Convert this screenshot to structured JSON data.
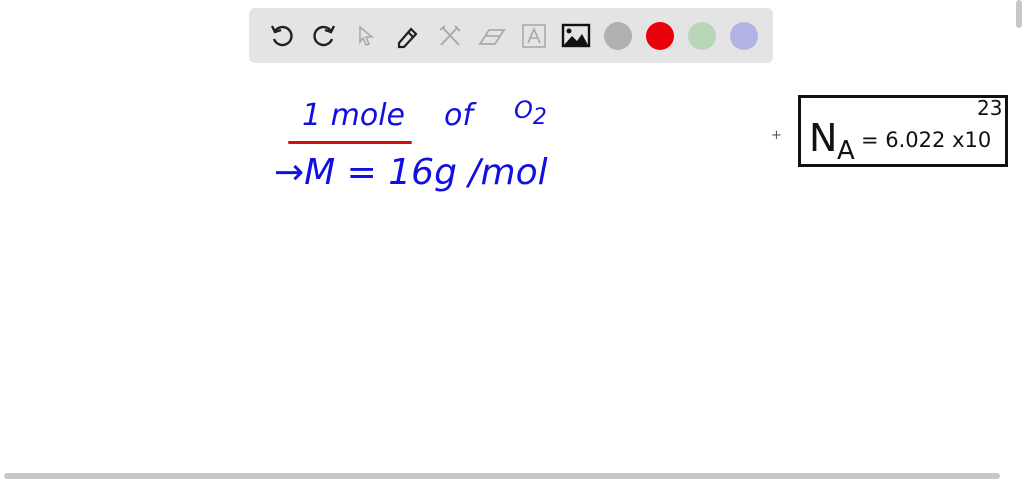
{
  "toolbar": {
    "tools": [
      "undo",
      "redo",
      "select",
      "pen",
      "tools",
      "eraser",
      "text",
      "image"
    ],
    "colors": [
      "#b0b0b0",
      "#e8000b",
      "#b9d6b9",
      "#b3b3e6"
    ]
  },
  "canvas": {
    "line1": "1 mole",
    "line1b": "of",
    "line1c": "O",
    "line1c_sub": "2",
    "line2": "→M = 16g /mol",
    "plus": "+",
    "na_label": "N",
    "na_sub": "A",
    "na_value": "= 6.022 x10",
    "na_exp": "23"
  },
  "colors": {
    "ink": "#1010e0",
    "underline": "#d01010"
  }
}
